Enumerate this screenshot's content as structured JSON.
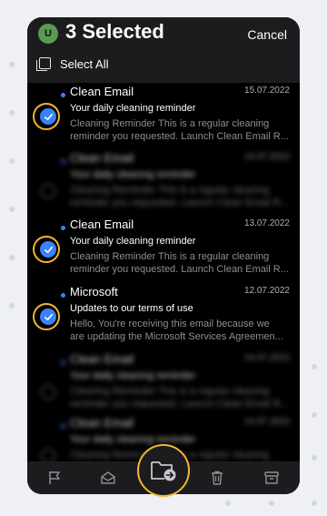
{
  "header": {
    "avatar_initial": "U",
    "title": "3 Selected",
    "cancel_label": "Cancel",
    "select_all_label": "Select All"
  },
  "emails": [
    {
      "selected": true,
      "blurred": false,
      "sender": "Clean Email",
      "date": "15.07.2022",
      "subject": "Your daily cleaning reminder",
      "preview_line1": "Cleaning Reminder This is a regular cleaning",
      "preview_line2": "reminder you requested. Launch Clean Email R..."
    },
    {
      "selected": false,
      "blurred": true,
      "sender": "Clean Email",
      "date": "14.07.2022",
      "subject": "Your daily cleaning reminder",
      "preview_line1": "Cleaning Reminder This is a regular cleaning",
      "preview_line2": "reminder you requested. Launch Clean Email R..."
    },
    {
      "selected": true,
      "blurred": false,
      "sender": "Clean Email",
      "date": "13.07.2022",
      "subject": "Your daily cleaning reminder",
      "preview_line1": "Cleaning Reminder This is a regular cleaning",
      "preview_line2": "reminder you requested. Launch Clean Email R..."
    },
    {
      "selected": true,
      "blurred": false,
      "sender": "Microsoft",
      "date": "12.07.2022",
      "subject": "Updates to our terms of use",
      "preview_line1": "Hello, You're receiving this email because we",
      "preview_line2": "are updating the Microsoft Services Agreemen..."
    },
    {
      "selected": false,
      "blurred": true,
      "sender": "Clean Email",
      "date": "14.07.2022",
      "subject": "Your daily cleaning reminder",
      "preview_line1": "Cleaning Reminder This is a regular cleaning",
      "preview_line2": "reminder you requested. Launch Clean Email R..."
    },
    {
      "selected": false,
      "blurred": true,
      "sender": "Clean Email",
      "date": "14.07.2022",
      "subject": "Your daily cleaning reminder",
      "preview_line1": "Cleaning Reminder This is a regular cleaning",
      "preview_line2": "reminder you requested. Launch Clean Email R..."
    }
  ],
  "toolbar": {
    "icons": [
      "flag-icon",
      "mark-read-icon",
      "move-to-folder-icon",
      "trash-icon",
      "archive-icon"
    ]
  },
  "colors": {
    "accent": "#3a82f7",
    "highlight_ring": "#f5b530",
    "background": "#000000",
    "header_bg": "#1c1c1e"
  }
}
